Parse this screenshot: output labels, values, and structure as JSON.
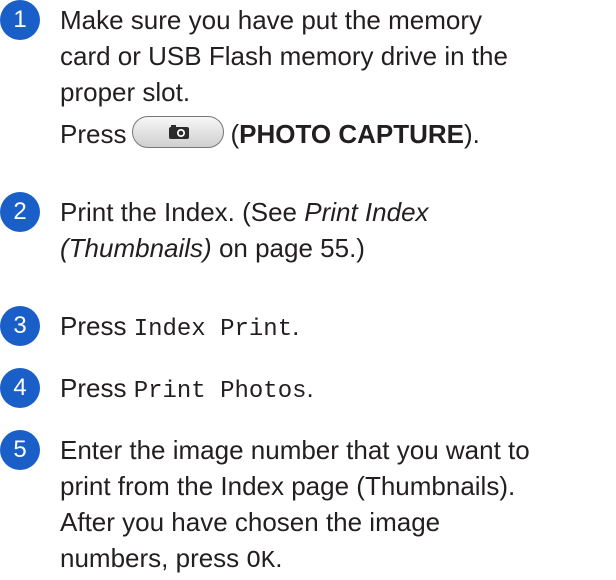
{
  "colors": {
    "badge": "#1a5fc8",
    "text": "#231f20"
  },
  "steps": [
    {
      "number": "1",
      "lines": [
        "Make sure you have put the memory",
        "card or USB Flash memory drive in the",
        "proper slot."
      ],
      "press_prefix": "Press",
      "press_button_icon": "camera-icon",
      "press_open": "(",
      "press_label": "PHOTO CAPTURE",
      "press_close": ")."
    },
    {
      "number": "2",
      "line1_text": "Print the Index. (See ",
      "line1_link": "Print Index",
      "line2_link": "(Thumbnails)",
      "line2_text": " on page 55.)"
    },
    {
      "number": "3",
      "prefix": "Press ",
      "command": "Index Print",
      "suffix": "."
    },
    {
      "number": "4",
      "prefix": "Press ",
      "command": "Print Photos",
      "suffix": "."
    },
    {
      "number": "5",
      "lines": [
        "Enter the image number that you want to",
        "print from the Index page (Thumbnails).",
        "After you have chosen the image"
      ],
      "last_prefix": "numbers, press ",
      "last_command": "OK",
      "last_suffix": "."
    }
  ]
}
